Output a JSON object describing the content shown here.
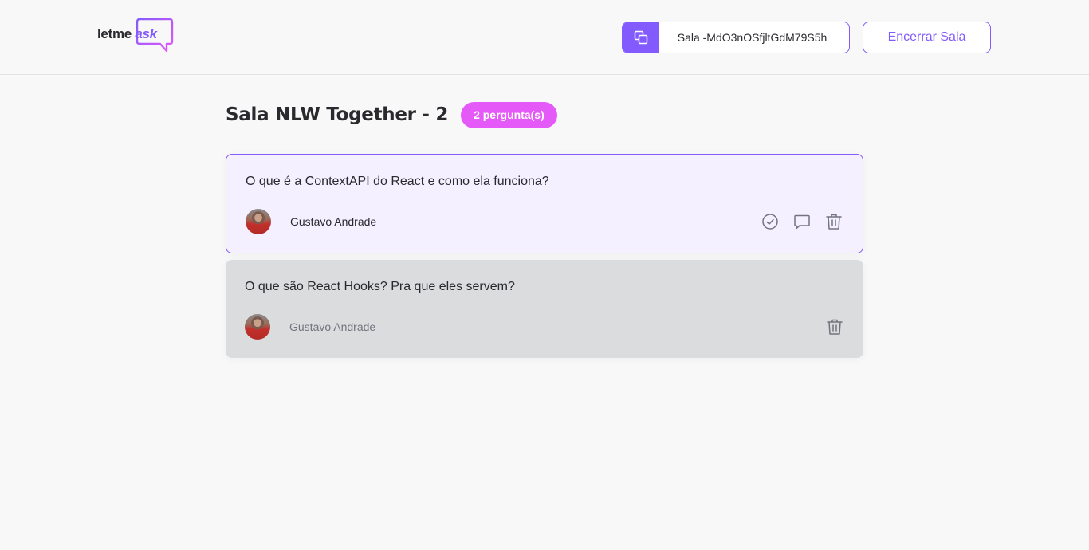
{
  "header": {
    "logo": {
      "prefix": "letme",
      "accent": "ask"
    },
    "room_code": {
      "label": "Sala -MdO3nOSfjltGdM79S5h"
    },
    "end_room_label": "Encerrar Sala"
  },
  "room": {
    "title": "Sala NLW Together - 2",
    "question_count_label": "2 pergunta(s)"
  },
  "questions": [
    {
      "content": "O que é a ContextAPI do React e como ela funciona?",
      "author": "Gustavo Andrade",
      "state": "highlighted"
    },
    {
      "content": "O que são React Hooks? Pra que eles servem?",
      "author": "Gustavo Andrade",
      "state": "answered"
    }
  ],
  "colors": {
    "accent": "#835afd",
    "badge": "#e559f9",
    "highlight_bg": "#f4f0ff",
    "answered_bg": "#dbdcdd",
    "icon": "#737380"
  },
  "icons": {
    "copy": "copy-icon",
    "check": "check-circle-icon",
    "answer": "answer-icon",
    "delete": "delete-icon"
  }
}
